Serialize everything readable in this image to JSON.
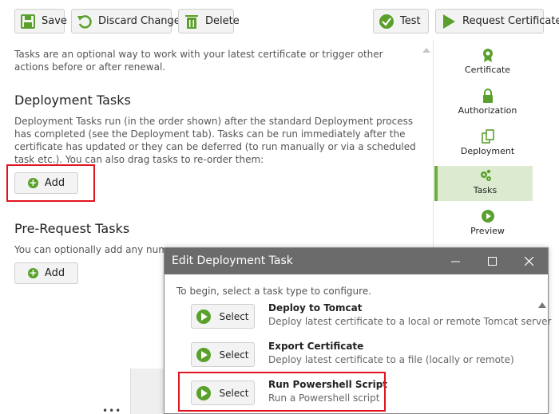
{
  "toolbar": {
    "save": "Save",
    "discard": "Discard Changes",
    "delete": "Delete",
    "test": "Test",
    "request": "Request Certificate"
  },
  "intro": "Tasks are an optional way to work with your latest certificate or trigger other actions before or after renewal.",
  "deployment": {
    "title": "Deployment Tasks",
    "description": "Deployment Tasks run (in the order shown) after the standard Deployment process has completed (see the Deployment tab). Tasks can be run immediately after the certificate has updated or they can be deferred (to run manually or via a scheduled task etc.). You can also drag tasks to re-order them:",
    "add": "Add"
  },
  "prerequest": {
    "title": "Pre-Request Tasks",
    "description": "You can optionally add any numbe",
    "add": "Add"
  },
  "nav": {
    "items": [
      {
        "label": "Certificate",
        "icon": "certificate-icon"
      },
      {
        "label": "Authorization",
        "icon": "lock-icon"
      },
      {
        "label": "Deployment",
        "icon": "deployment-icon"
      },
      {
        "label": "Tasks",
        "icon": "gears-icon"
      },
      {
        "label": "Preview",
        "icon": "play-icon"
      }
    ],
    "active": "Tasks"
  },
  "dialog": {
    "title": "Edit Deployment Task",
    "subtitle": "To begin, select a task type to configure.",
    "select": "Select",
    "tasks": [
      {
        "title": "Deploy to Tomcat",
        "description": "Deploy latest certificate to a local or remote Tomcat server"
      },
      {
        "title": "Export Certificate",
        "description": "Deploy latest certificate to a file (locally or remote)"
      },
      {
        "title": "Run Powershell Script",
        "description": "Run a Powershell script"
      }
    ]
  },
  "colors": {
    "accent_green": "#5aa02c",
    "highlight_red": "#e0141e",
    "dialog_title_bg": "#6b6b6b",
    "nav_active_bg": "#dcebd0"
  }
}
